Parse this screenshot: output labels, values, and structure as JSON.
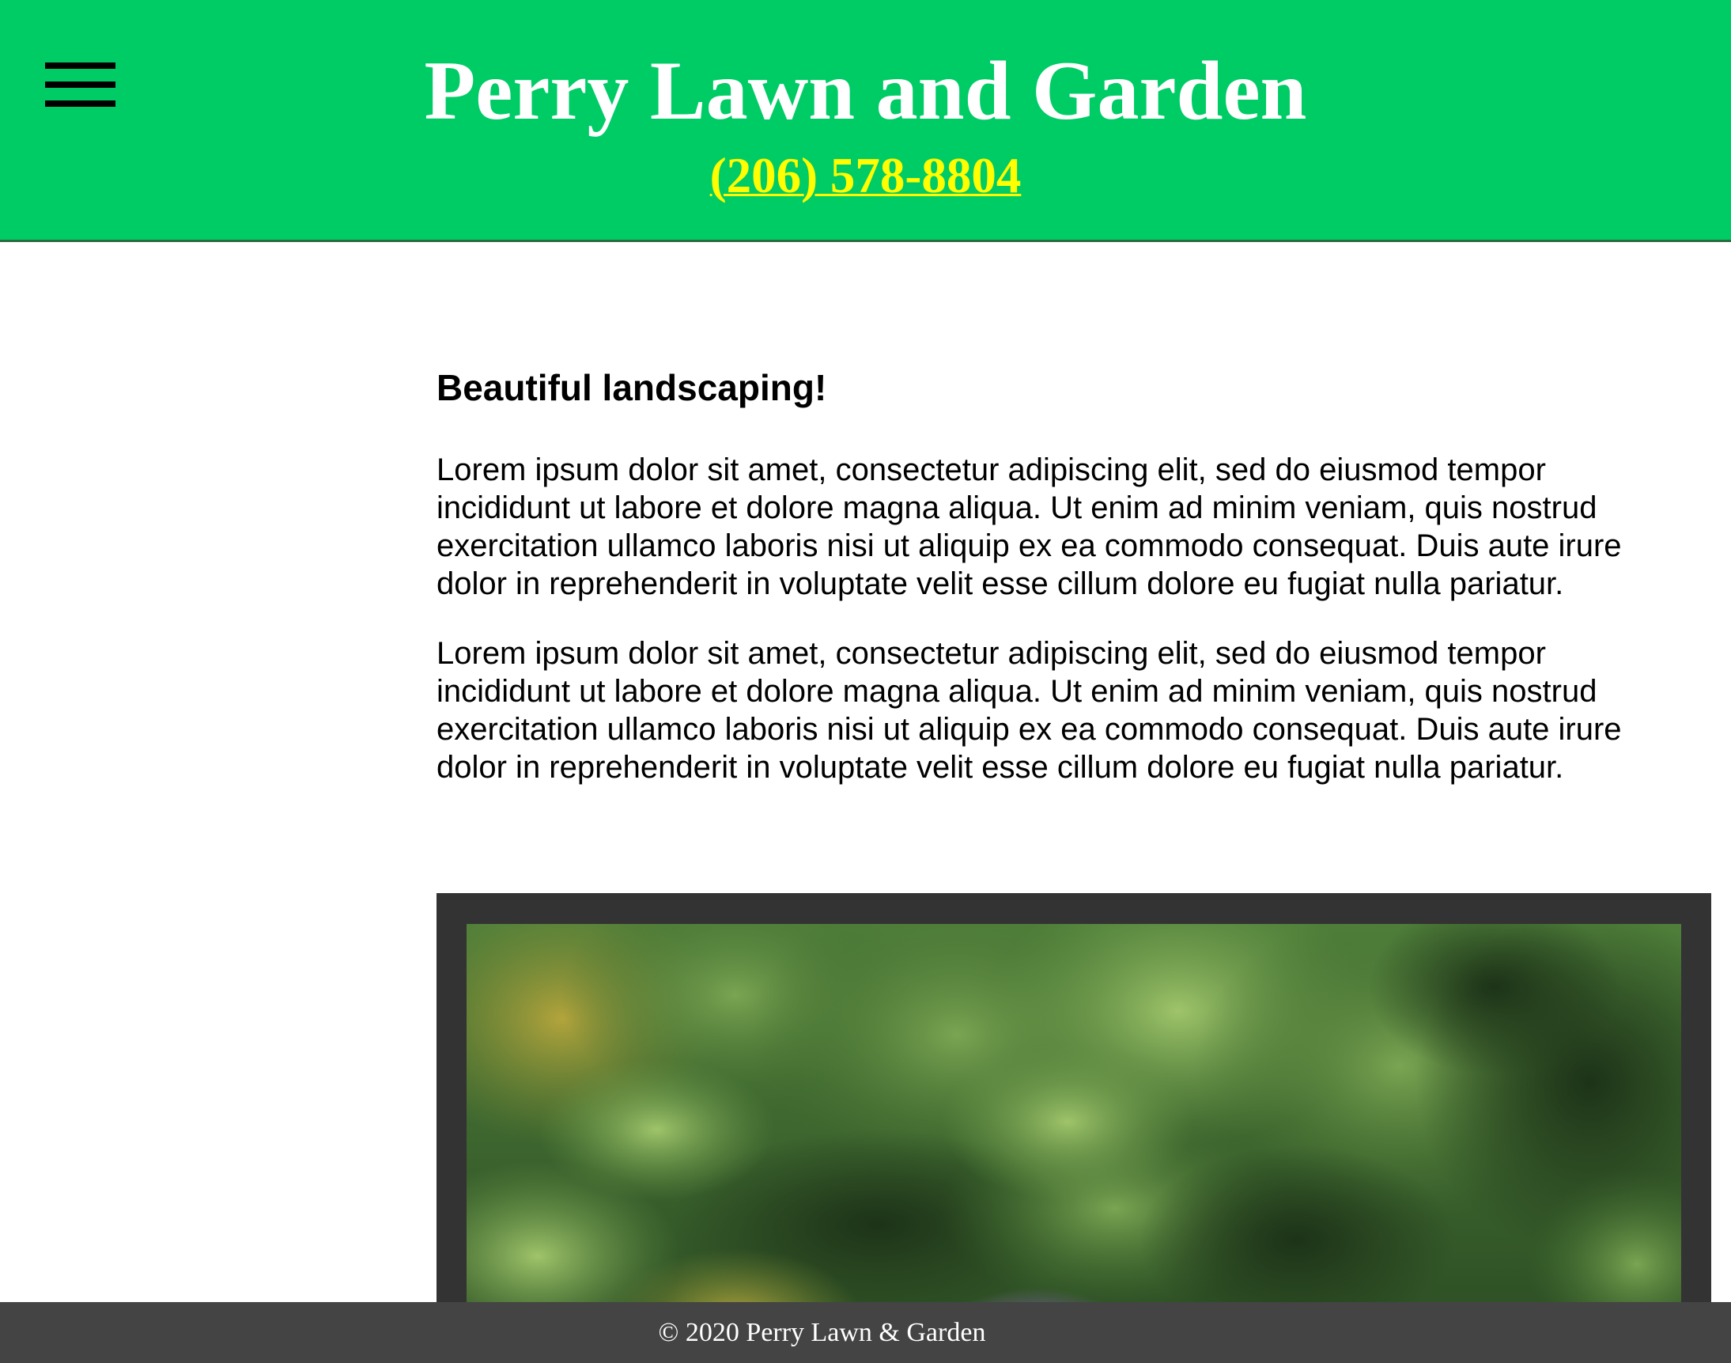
{
  "header": {
    "title": "Perry Lawn and Garden",
    "phone": "(206) 578-8804",
    "menu_icon": "hamburger-menu-icon",
    "background_color": "#00cc66",
    "phone_color": "#ffff00"
  },
  "main": {
    "heading": "Beautiful landscaping!",
    "paragraphs": [
      "Lorem ipsum dolor sit amet, consectetur adipiscing elit, sed do eiusmod tempor incididunt ut labore et dolore magna aliqua. Ut enim ad minim veniam, quis nostrud exercitation ullamco laboris nisi ut aliquip ex ea commodo consequat. Duis aute irure dolor in reprehenderit in voluptate velit esse cillum dolore eu fugiat nulla pariatur.",
      "Lorem ipsum dolor sit amet, consectetur adipiscing elit, sed do eiusmod tempor incididunt ut labore et dolore magna aliqua. Ut enim ad minim veniam, quis nostrud exercitation ullamco laboris nisi ut aliquip ex ea commodo consequat. Duis aute irure dolor in reprehenderit in voluptate velit esse cillum dolore eu fugiat nulla pariatur."
    ],
    "photo_frame_color": "#333333"
  },
  "footer": {
    "text": "© 2020 Perry Lawn & Garden",
    "background_color": "#444444"
  }
}
